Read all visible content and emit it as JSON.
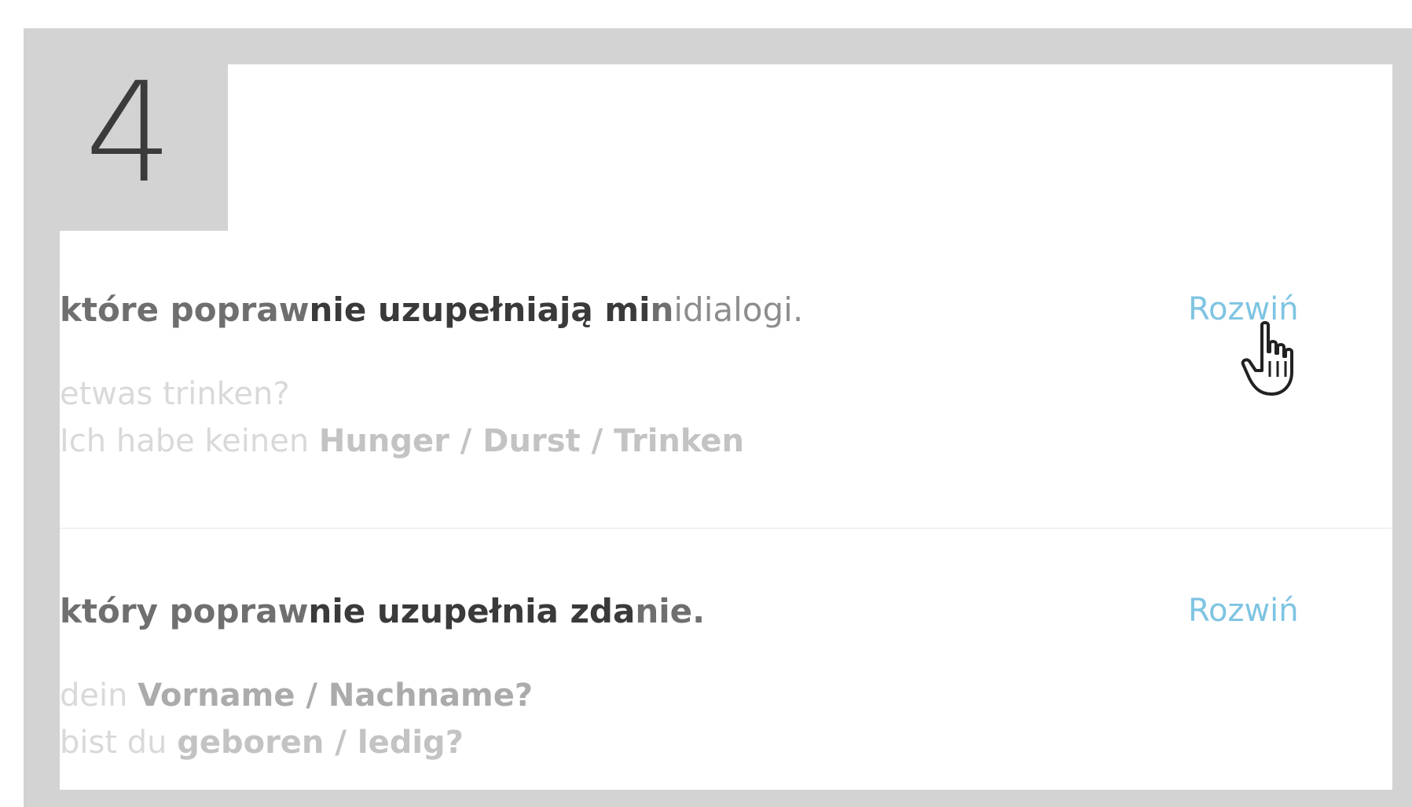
{
  "step": {
    "number": "4"
  },
  "exercises": [
    {
      "instruction_parts": {
        "p1": "które popraw",
        "p2": "nie uzupełniają mi",
        "p3": "n",
        "p4": "idialogi."
      },
      "expand_label": "Rozwiń",
      "lines": [
        {
          "t1": "etwas trinken?"
        },
        {
          "t1": "Ich habe keinen ",
          "t2": "Hunger / Durst / Trinken"
        }
      ]
    },
    {
      "instruction_parts": {
        "p1": "który popraw",
        "p2": "nie uzupełnia zda",
        "p3": "nie."
      },
      "expand_label": "Rozwiń",
      "lines": [
        {
          "t1": "dein ",
          "t2": "Vorname / Nachname?"
        },
        {
          "t1": "bist du ",
          "t2": "geboren / ledig?"
        }
      ]
    }
  ],
  "cursor": {
    "icon": "hand-pointer-icon"
  },
  "colors": {
    "frame": "#d3d3d3",
    "panel": "#ffffff",
    "link": "#7ec4e2",
    "text_dark": "#3a3a3a",
    "text_faded": "#d9d9d9"
  }
}
